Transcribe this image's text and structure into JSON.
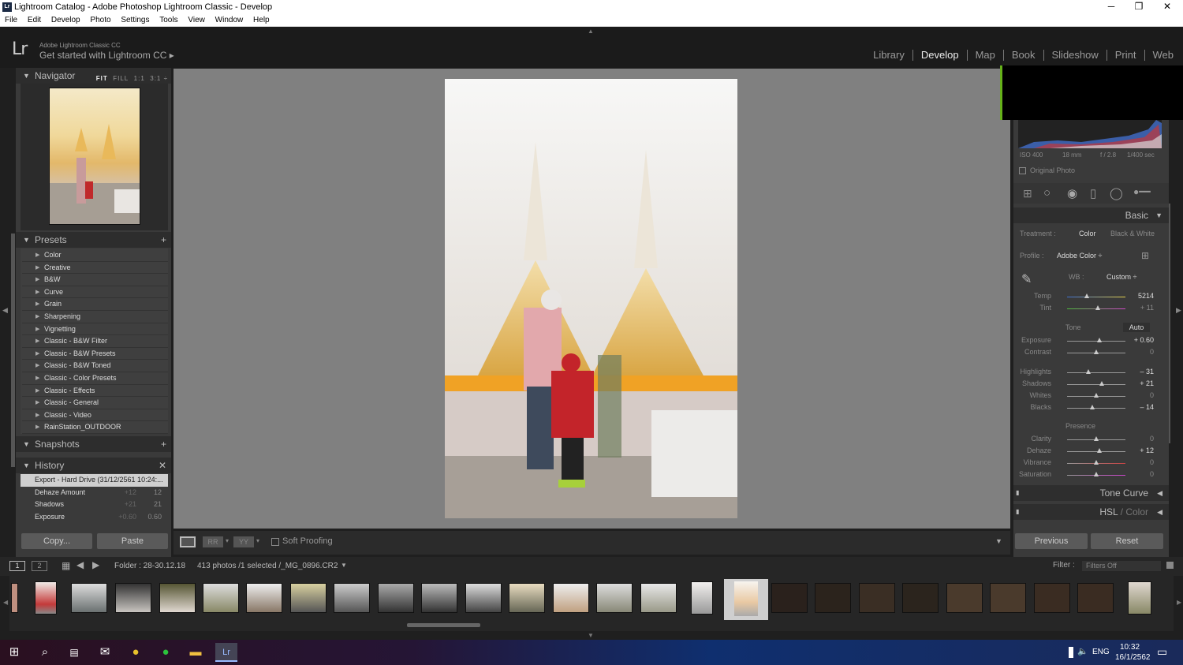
{
  "window": {
    "title": "Lightroom Catalog - Adobe Photoshop Lightroom Classic - Develop",
    "icon": "Lr",
    "minimize": "─",
    "maximize": "❐",
    "close": "✕"
  },
  "menu": [
    "File",
    "Edit",
    "Develop",
    "Photo",
    "Settings",
    "Tools",
    "View",
    "Window",
    "Help"
  ],
  "identity": {
    "logo": "Lr",
    "product": "Adobe Lightroom Classic CC",
    "promo": "Get started with Lightroom CC ▸"
  },
  "modules": [
    "Library",
    "Develop",
    "Map",
    "Book",
    "Slideshow",
    "Print",
    "Web"
  ],
  "active_module": "Develop",
  "navigator": {
    "title": "Navigator",
    "zoom_options": [
      "FIT",
      "FILL",
      "1:1",
      "3:1"
    ],
    "selected_zoom": "FIT"
  },
  "presets": {
    "title": "Presets",
    "add": "+",
    "items": [
      "Color",
      "Creative",
      "B&W",
      "Curve",
      "Grain",
      "Sharpening",
      "Vignetting",
      "Classic - B&W Filter",
      "Classic - B&W Presets",
      "Classic - B&W Toned",
      "Classic - Color Presets",
      "Classic - Effects",
      "Classic - General",
      "Classic - Video",
      "RainStation_OUTDOOR"
    ]
  },
  "snapshots": {
    "title": "Snapshots",
    "add": "+"
  },
  "history": {
    "title": "History",
    "clear": "✕",
    "items": [
      {
        "name": "Export - Hard Drive (31/12/2561 10:24:...",
        "a": "",
        "b": ""
      },
      {
        "name": "Dehaze Amount",
        "a": "+12",
        "b": "12"
      },
      {
        "name": "Shadows",
        "a": "+21",
        "b": "21"
      },
      {
        "name": "Exposure",
        "a": "+0.60",
        "b": "0.60"
      }
    ]
  },
  "left_buttons": {
    "copy": "Copy...",
    "paste": "Paste"
  },
  "toolbar": {
    "soft_proofing": "Soft Proofing"
  },
  "histogram_info": {
    "iso": "ISO 400",
    "focal": "18 mm",
    "aperture": "f / 2.8",
    "shutter": "1/400 sec",
    "original": "Original Photo"
  },
  "basic": {
    "title": "Basic",
    "treatment_label": "Treatment :",
    "treatment_color": "Color",
    "treatment_bw": "Black & White",
    "profile_label": "Profile :",
    "profile_value": "Adobe Color ÷",
    "wb_label": "WB :",
    "wb_value": "Custom ÷",
    "temp": {
      "label": "Temp",
      "value": "5214",
      "pos": 0.38
    },
    "tint": {
      "label": "Tint",
      "value": "+ 11",
      "pos": 0.53
    },
    "tone_label": "Tone",
    "auto": "Auto",
    "exposure": {
      "label": "Exposure",
      "value": "+ 0.60",
      "pos": 0.56
    },
    "contrast": {
      "label": "Contrast",
      "value": "0",
      "pos": 0.5
    },
    "highlights": {
      "label": "Highlights",
      "value": "– 31",
      "pos": 0.35
    },
    "shadows": {
      "label": "Shadows",
      "value": "+ 21",
      "pos": 0.6
    },
    "whites": {
      "label": "Whites",
      "value": "0",
      "pos": 0.5
    },
    "blacks": {
      "label": "Blacks",
      "value": "– 14",
      "pos": 0.43
    },
    "presence_label": "Presence",
    "clarity": {
      "label": "Clarity",
      "value": "0",
      "pos": 0.5
    },
    "dehaze": {
      "label": "Dehaze",
      "value": "+ 12",
      "pos": 0.56
    },
    "vibrance": {
      "label": "Vibrance",
      "value": "0",
      "pos": 0.5
    },
    "saturation": {
      "label": "Saturation",
      "value": "0",
      "pos": 0.5
    }
  },
  "tone_curve": "Tone Curve",
  "hsl": {
    "hsl": "HSL",
    "sep": " / ",
    "color": "Color"
  },
  "right_buttons": {
    "previous": "Previous",
    "reset": "Reset"
  },
  "filmbar": {
    "page1": "1",
    "page2": "2",
    "folder": "Folder : 28-30.12.18",
    "count": "413 photos /1 selected /_MG_0896.CR2",
    "filter_label": "Filter :",
    "filter_value": "Filters Off"
  },
  "taskbar": {
    "lang": "ENG",
    "time": "10:32",
    "date": "16/1/2562"
  }
}
